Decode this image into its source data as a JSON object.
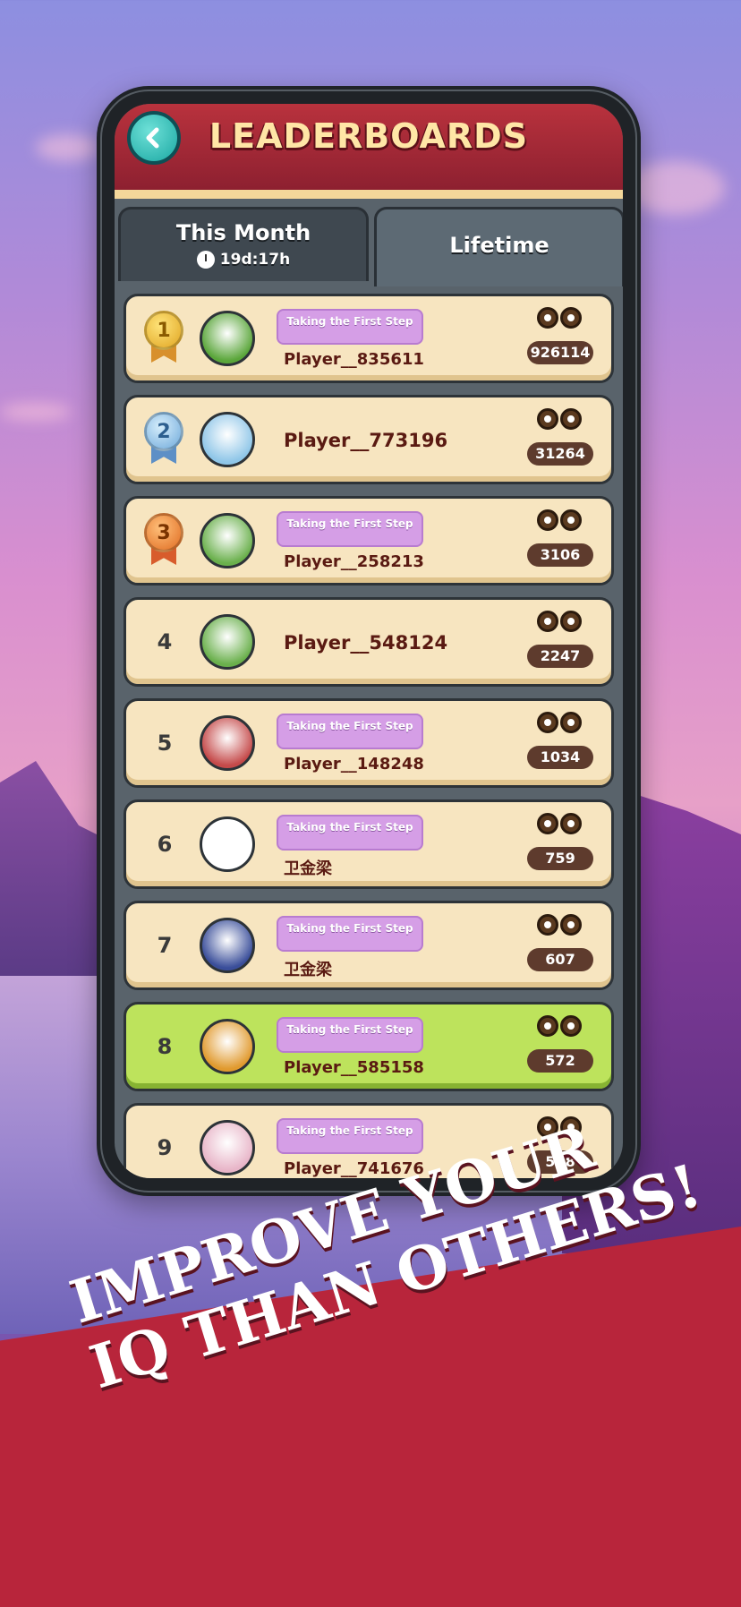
{
  "header": {
    "title": "LEADERBOARDS",
    "back_icon": "chevron-left-icon"
  },
  "tabs": {
    "month": {
      "label": "This Month",
      "timer": "19d:17h"
    },
    "lifetime": {
      "label": "Lifetime",
      "active": true
    }
  },
  "rows": [
    {
      "rank": "1",
      "medal": "gold",
      "badge": "Taking the First Step",
      "name": "Player__835611",
      "score": "926114",
      "avatar": "#5aa63a"
    },
    {
      "rank": "2",
      "medal": "silver",
      "badge": "",
      "name": "Player__773196",
      "score": "31264",
      "avatar": "#8fc6e8"
    },
    {
      "rank": "3",
      "medal": "bronze",
      "badge": "Taking the First Step",
      "name": "Player__258213",
      "score": "3106",
      "avatar": "#6ab04c"
    },
    {
      "rank": "4",
      "medal": "",
      "badge": "",
      "name": "Player__548124",
      "score": "2247",
      "avatar": "#6ab04c"
    },
    {
      "rank": "5",
      "medal": "",
      "badge": "Taking the First Step",
      "name": "Player__148248",
      "score": "1034",
      "avatar": "#c54a4a"
    },
    {
      "rank": "6",
      "medal": "",
      "badge": "Taking the First Step",
      "name": "卫金梁",
      "score": "759",
      "avatar": "#ffffff"
    },
    {
      "rank": "7",
      "medal": "",
      "badge": "Taking the First Step",
      "name": "卫金梁",
      "score": "607",
      "avatar": "#3a4e9a"
    },
    {
      "rank": "8",
      "medal": "",
      "badge": "Taking the First Step",
      "name": "Player__585158",
      "score": "572",
      "avatar": "#e19a2e",
      "highlight": true
    },
    {
      "rank": "9",
      "medal": "",
      "badge": "Taking the First Step",
      "name": "Player__741676",
      "score": "518",
      "avatar": "#e8b5c8"
    }
  ],
  "promo": {
    "line1": "IMPROVE YOUR",
    "line2": "IQ THAN OTHERS!"
  }
}
